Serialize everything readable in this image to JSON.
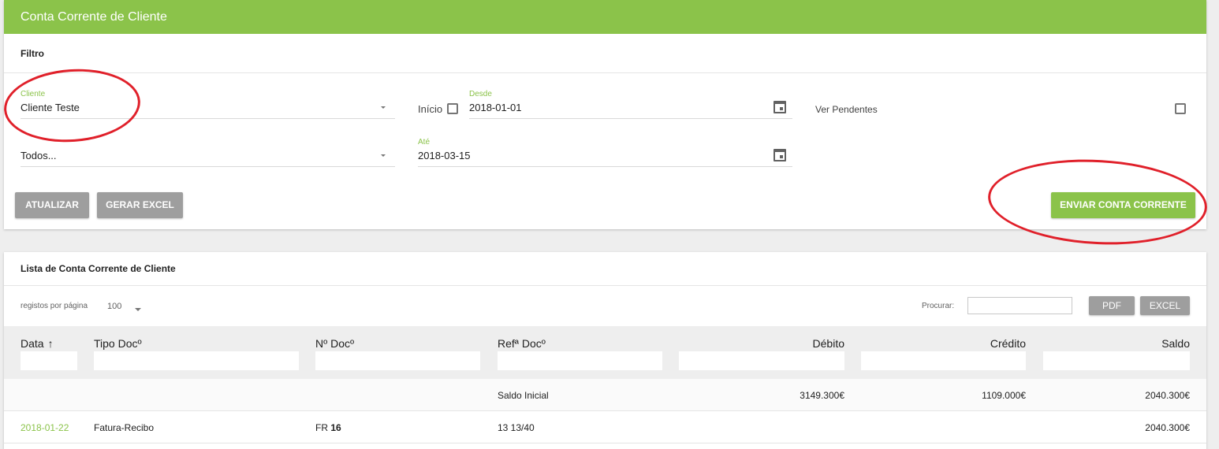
{
  "header": {
    "title": "Conta Corrente de Cliente"
  },
  "filter": {
    "section_title": "Filtro",
    "cliente_label": "Cliente",
    "cliente_value": "Cliente Teste",
    "tipo_value": "Todos...",
    "inicio_label": "Início",
    "desde_label": "Desde",
    "desde_value": "2018-01-01",
    "ate_label": "Até",
    "ate_value": "2018-03-15",
    "ver_pendentes_label": "Ver Pendentes",
    "atualizar_button": "ATUALIZAR",
    "gerar_excel_button": "GERAR EXCEL",
    "enviar_button": "ENVIAR CONTA CORRENTE"
  },
  "list": {
    "section_title": "Lista de Conta Corrente de Cliente",
    "per_page_label": "registos por página",
    "per_page_value": "100",
    "search_label": "Procurar:",
    "pdf_button": "PDF",
    "excel_button": "EXCEL",
    "columns": [
      "Data",
      "Tipo Docº",
      "Nº Docº",
      "Refª Docº",
      "Débito",
      "Crédito",
      "Saldo"
    ],
    "sort_icon": "arrow-up-icon",
    "rows": [
      {
        "data": "",
        "tipo": "",
        "doc_prefix": "",
        "doc_number": "",
        "ref": "Saldo Inicial",
        "debito": "3149.300€",
        "credito": "1109.000€",
        "saldo": "2040.300€"
      },
      {
        "data": "2018-01-22",
        "tipo": "Fatura-Recibo",
        "doc_prefix": "FR",
        "doc_number": "16",
        "ref": "13 13/40",
        "debito": "",
        "credito": "",
        "saldo": "2040.300€"
      }
    ]
  },
  "colors": {
    "accent": "#8bc34a",
    "annotation": "#e0202a",
    "button_grey": "#9e9e9e"
  }
}
